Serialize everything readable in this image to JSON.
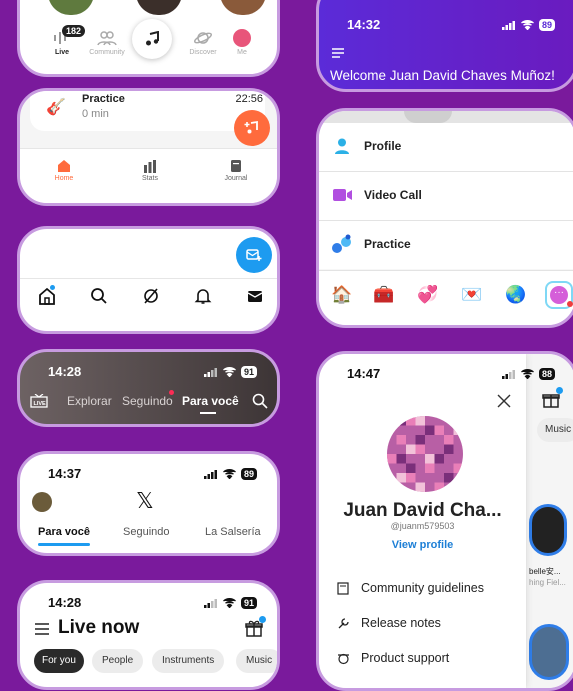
{
  "music_nav": {
    "badge": "182",
    "items": [
      {
        "label": "Live"
      },
      {
        "label": "Community"
      },
      {
        "label": "Discover"
      },
      {
        "label": "Me"
      }
    ]
  },
  "practice_app": {
    "item_title": "Practice",
    "item_sub": "0 min",
    "time": "22:56",
    "tabs": [
      {
        "label": "Home"
      },
      {
        "label": "Stats"
      },
      {
        "label": "Journal"
      }
    ]
  },
  "welcome_app": {
    "time": "14:32",
    "battery": "89",
    "welcome": "Welcome Juan David Chaves Muñoz!"
  },
  "menu_app": {
    "items": [
      {
        "label": "Profile"
      },
      {
        "label": "Video Call"
      },
      {
        "label": "Practice"
      }
    ]
  },
  "x_top": {},
  "tiktok": {
    "time": "14:28",
    "battery": "91",
    "tabs": [
      "Explorar",
      "Seguindo",
      "Para você"
    ]
  },
  "x_app": {
    "time": "14:37",
    "battery": "89",
    "logo": "𝕏",
    "tabs": [
      "Para você",
      "Seguindo",
      "La Salsería"
    ]
  },
  "live_app": {
    "time": "14:28",
    "battery": "91",
    "title": "Live now",
    "chips": [
      "For you",
      "People",
      "Instruments",
      "Music"
    ]
  },
  "profile_app": {
    "time": "14:47",
    "battery": "88",
    "name": "Juan David Cha...",
    "handle": "@juanm579503",
    "view_profile": "View profile",
    "menu": [
      "Community guidelines",
      "Release notes",
      "Product support"
    ],
    "side_tab": "Music",
    "side_caption1": "belle安...",
    "side_caption2": "hing Fiel..."
  },
  "colors": {
    "background": "#7a1a9c",
    "card_border": "#c79be0",
    "accent_orange": "#ff6b3d",
    "accent_blue": "#1d9bf0",
    "welcome_gradient_start": "#5b2bd8",
    "welcome_gradient_end": "#6a1bbf"
  }
}
